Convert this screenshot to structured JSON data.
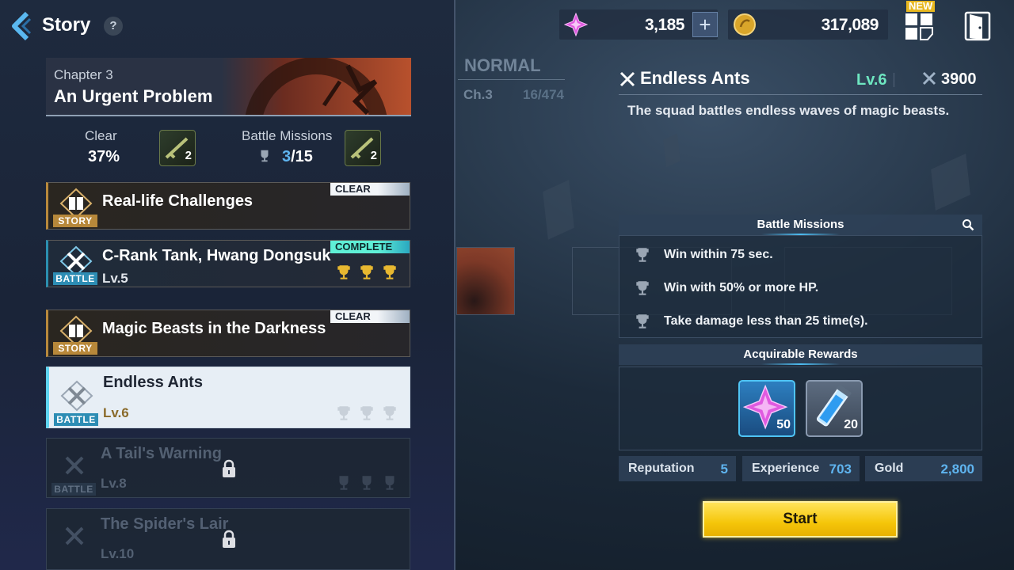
{
  "header": {
    "title": "Story",
    "help_label": "?"
  },
  "chapter": {
    "number": "Chapter 3",
    "name": "An Urgent Problem",
    "clear_label": "Clear",
    "clear_value": "37%",
    "clear_reward_count": "2",
    "missions_label": "Battle Missions",
    "missions_done": "3",
    "missions_total": "/15",
    "missions_reward_count": "2"
  },
  "missions": [
    {
      "title": "Real-life Challenges",
      "type": "STORY",
      "status": "CLEAR"
    },
    {
      "title": "C-Rank Tank, Hwang Dongsuk",
      "type": "BATTLE",
      "status": "COMPLETE",
      "level": "Lv.5",
      "trophies_earned": 3
    },
    {
      "title": "Magic Beasts in the Darkness",
      "type": "STORY",
      "status": "CLEAR"
    },
    {
      "title": "Endless Ants",
      "type": "BATTLE",
      "level": "Lv.6",
      "trophies_earned": 0,
      "selected": true
    },
    {
      "title": "A Tail's Warning",
      "type": "BATTLE",
      "level": "Lv.8",
      "locked": true
    },
    {
      "title": "The Spider's Lair",
      "type": "BATTLE",
      "level": "Lv.10",
      "locked": true
    }
  ],
  "currency": {
    "gems": "3,185",
    "plus_label": "+",
    "gold": "317,089",
    "new_label": "NEW"
  },
  "background": {
    "difficulty": "NORMAL",
    "chapter": "Ch.3",
    "progress": "16/474"
  },
  "detail": {
    "title": "Endless Ants",
    "level": "Lv.6",
    "power": "3900",
    "description": "The squad battles endless waves of magic beasts.",
    "battle_missions_header": "Battle Missions",
    "battle_missions": [
      "Win within 75 sec.",
      "Win with 50% or more HP.",
      "Take damage less than 25 time(s)."
    ],
    "rewards_header": "Acquirable Rewards",
    "rewards": [
      {
        "icon": "pink-crystal-icon",
        "qty": "50"
      },
      {
        "icon": "blue-vial-icon",
        "qty": "20"
      }
    ],
    "stats": {
      "reputation_label": "Reputation",
      "reputation": "5",
      "experience_label": "Experience",
      "experience": "703",
      "gold_label": "Gold",
      "gold": "2,800"
    },
    "start_label": "Start"
  },
  "colors": {
    "accent_cyan": "#5ed4f0",
    "level_green": "#6ee6c0",
    "start_yellow": "#f5c60a",
    "story_gold": "#b7883a",
    "battle_blue": "#2d8db4"
  }
}
